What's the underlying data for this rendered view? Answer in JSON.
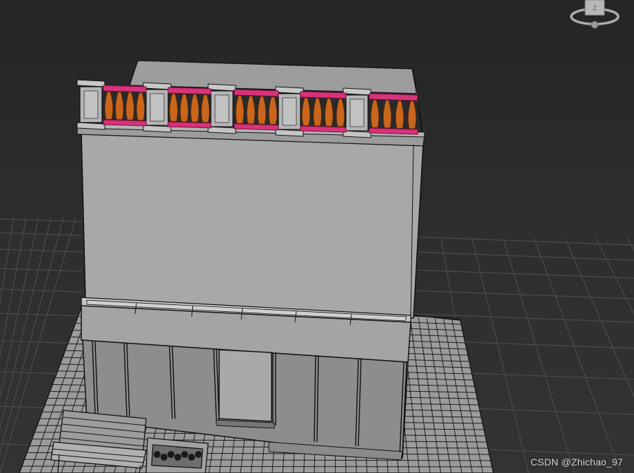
{
  "viewport": {
    "name": "3D viewport",
    "background_color": "#2e2e2e",
    "grid_color": "#4a4a4a"
  },
  "model": {
    "wall_color": "#a7a7a7",
    "wall_edge_color": "#111111",
    "paving_color": "#9a9a9a",
    "glass_color": "#8a8a8a",
    "selected_rail_color": "#d8337a",
    "baluster_color": "#c9661c"
  },
  "viewcube": {
    "icon": "viewcube-compass-icon"
  },
  "watermark": {
    "text": "CSDN @Zhichao_97"
  }
}
